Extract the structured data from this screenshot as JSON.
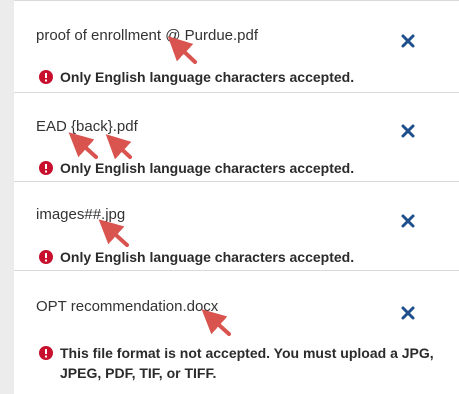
{
  "files": [
    {
      "name": "proof of enrollment @ Purdue.pdf",
      "error": "Only English language characters accepted.",
      "remove_icon": "close-icon",
      "error_icon": "alert-circle-icon"
    },
    {
      "name": "EAD {back}.pdf",
      "error": "Only English language characters accepted.",
      "remove_icon": "close-icon",
      "error_icon": "alert-circle-icon"
    },
    {
      "name": "images##.jpg",
      "error": "Only English language characters accepted.",
      "remove_icon": "close-icon",
      "error_icon": "alert-circle-icon"
    },
    {
      "name": "OPT recommendation.docx",
      "error": "This file format is not accepted. You must upload a JPG, JPEG, PDF, TIF, or TIFF.",
      "remove_icon": "close-icon",
      "error_icon": "alert-circle-icon"
    }
  ],
  "colors": {
    "close": "#1f4e8c",
    "error": "#c8102e",
    "arrow": "#d9534f"
  }
}
